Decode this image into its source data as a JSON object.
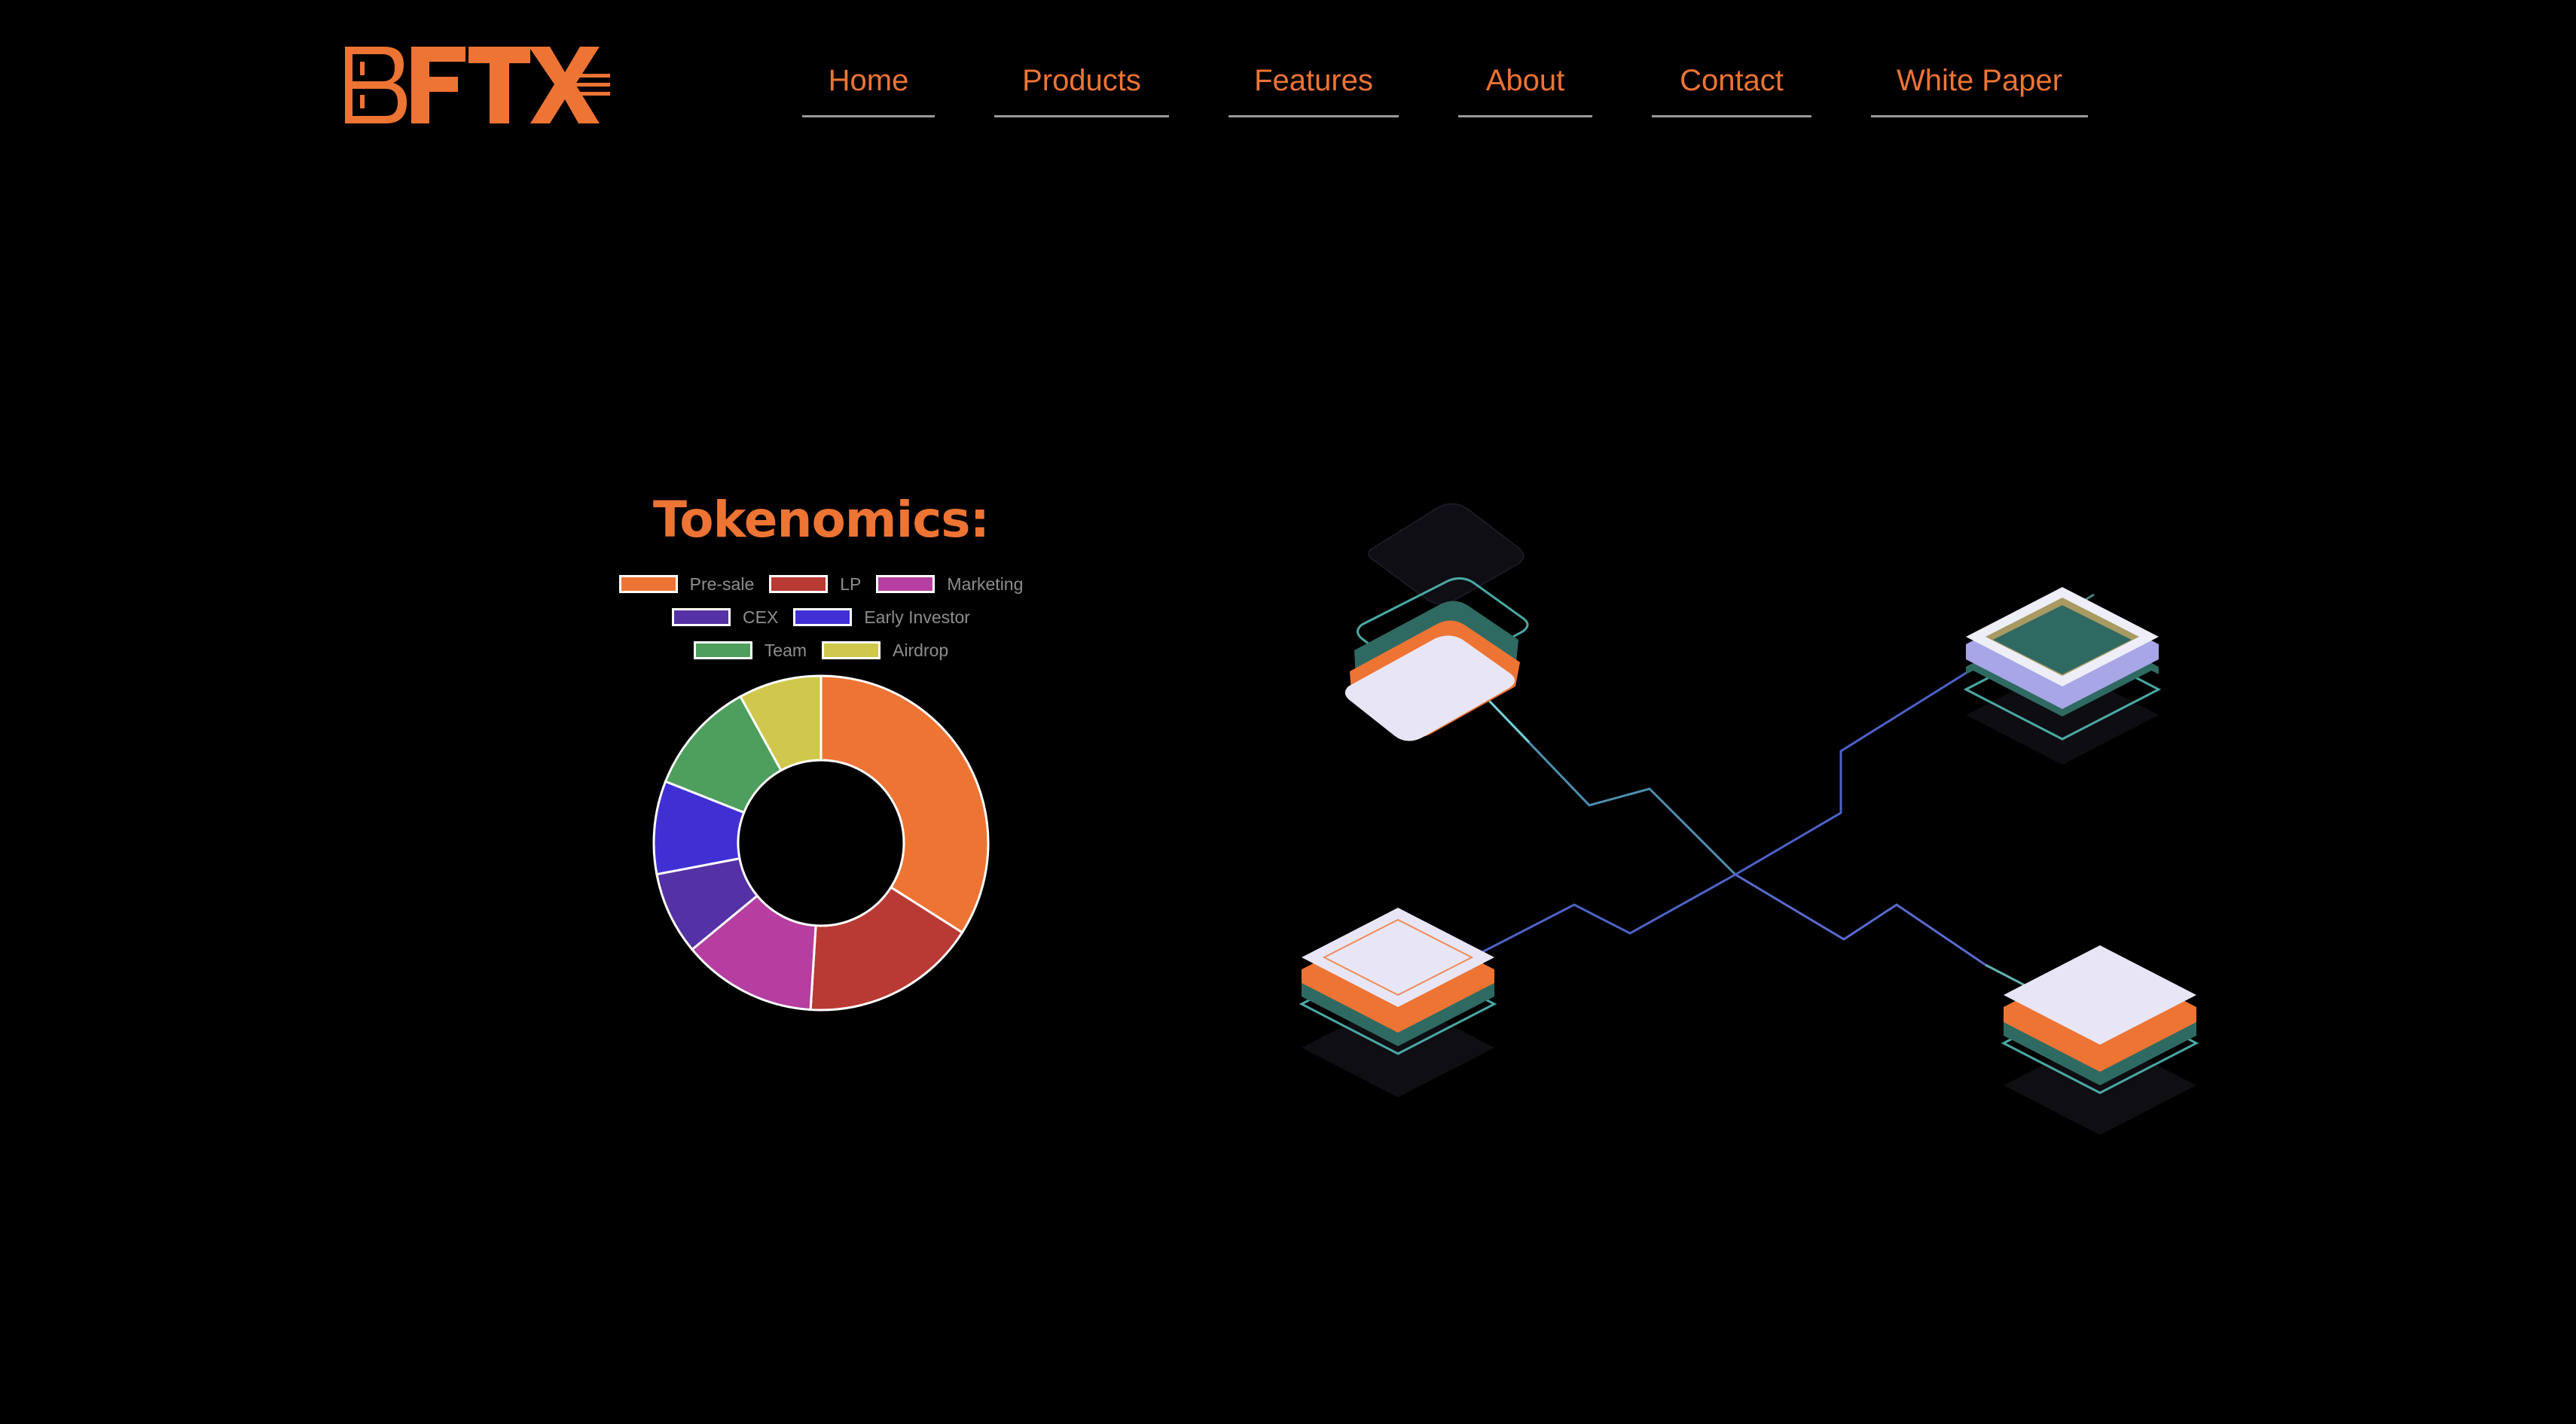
{
  "brand": {
    "logo_text": "BFTX",
    "color": "#ee7434"
  },
  "nav": {
    "items": [
      {
        "label": "Home"
      },
      {
        "label": "Products"
      },
      {
        "label": "Features"
      },
      {
        "label": "About"
      },
      {
        "label": "Contact"
      },
      {
        "label": "White Paper"
      }
    ]
  },
  "tokenomics": {
    "title": "Tokenomics:",
    "legend": [
      {
        "label": "Pre-sale",
        "color": "#ee7434"
      },
      {
        "label": "LP",
        "color": "#b93a34"
      },
      {
        "label": "Marketing",
        "color": "#b53ea0"
      },
      {
        "label": "CEX",
        "color": "#5431a4"
      },
      {
        "label": "Early Investor",
        "color": "#4030d4"
      },
      {
        "label": "Team",
        "color": "#4e9e5e"
      },
      {
        "label": "Airdrop",
        "color": "#d0c84c"
      }
    ]
  },
  "chart_data": {
    "type": "pie",
    "variant": "doughnut",
    "title": "Tokenomics:",
    "categories": [
      "Pre-sale",
      "LP",
      "Marketing",
      "CEX",
      "Early Investor",
      "Team",
      "Airdrop"
    ],
    "values": [
      34,
      17,
      13,
      8,
      9,
      11,
      8
    ],
    "colors": [
      "#ee7434",
      "#b93a34",
      "#b53ea0",
      "#5431a4",
      "#4030d4",
      "#4e9e5e",
      "#d0c84c"
    ],
    "legend_position": "top"
  },
  "illustration": {
    "description_icon": "isometric-network-icon",
    "accent": "#ee7434",
    "teal": "#2f6a62",
    "face": "#e8e6f6"
  }
}
